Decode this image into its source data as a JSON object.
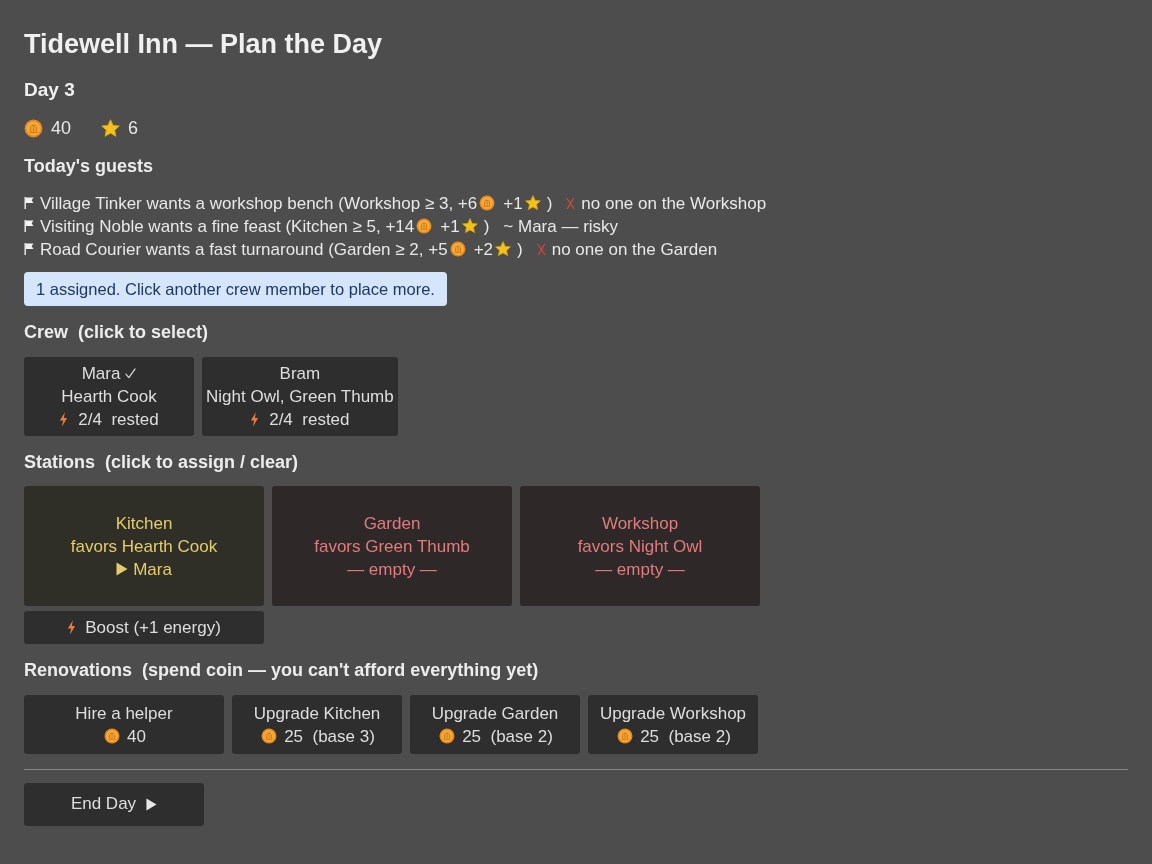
{
  "title": "Tidewell Inn — Plan the Day",
  "day": "Day 3",
  "resources": [
    {
      "kind": "coin",
      "value": "40"
    },
    {
      "kind": "star",
      "value": "6"
    }
  ],
  "guests_heading": "Today's guests",
  "guests": [
    {
      "request": "Village Tinker wants a workshop bench (Workshop ≥ 3, +6",
      "star_gain": "+1",
      "end": ")",
      "status": {
        "kind": "blocked",
        "text": "no one on the Workshop"
      }
    },
    {
      "request": "Visiting Noble wants a fine feast (Kitchen ≥ 5, +14",
      "star_gain": "+1",
      "end": ")",
      "status": {
        "kind": "risky",
        "text": "~ Mara — risky"
      }
    },
    {
      "request": "Road Courier wants a fast turnaround (Garden ≥ 2, +5",
      "star_gain": "+2",
      "end": ")",
      "status": {
        "kind": "blocked",
        "text": "no one on the Garden"
      }
    }
  ],
  "notice": "1 assigned. Click another crew member to place more.",
  "crew_heading": "Crew  (click to select)",
  "crew": [
    {
      "name": "Mara",
      "selected": true,
      "trait": "Hearth Cook",
      "energy": "2/4  rested"
    },
    {
      "name": "Bram",
      "selected": false,
      "trait": "Night Owl, Green Thumb",
      "energy": "2/4  rested"
    }
  ],
  "stations_heading": "Stations  (click to assign / clear)",
  "stations": [
    {
      "name": "Kitchen",
      "favors": "favors Hearth Cook",
      "kind": "staffed",
      "occupant": "Mara",
      "boost": "Boost (+1 energy)"
    },
    {
      "name": "Garden",
      "favors": "favors Green Thumb",
      "kind": "empty",
      "occupant": "— empty —"
    },
    {
      "name": "Workshop",
      "favors": "favors Night Owl",
      "kind": "empty",
      "occupant": "— empty —"
    }
  ],
  "renovations_heading": "Renovations  (spend coin — you can't afford everything yet)",
  "renovations": [
    {
      "label": "Hire a helper",
      "cost": "40"
    },
    {
      "label": "Upgrade Kitchen",
      "cost": "25  (base 3)"
    },
    {
      "label": "Upgrade Garden",
      "cost": "25  (base 2)"
    },
    {
      "label": "Upgrade Workshop",
      "cost": "25  (base 2)"
    }
  ],
  "end_button": "End Day"
}
